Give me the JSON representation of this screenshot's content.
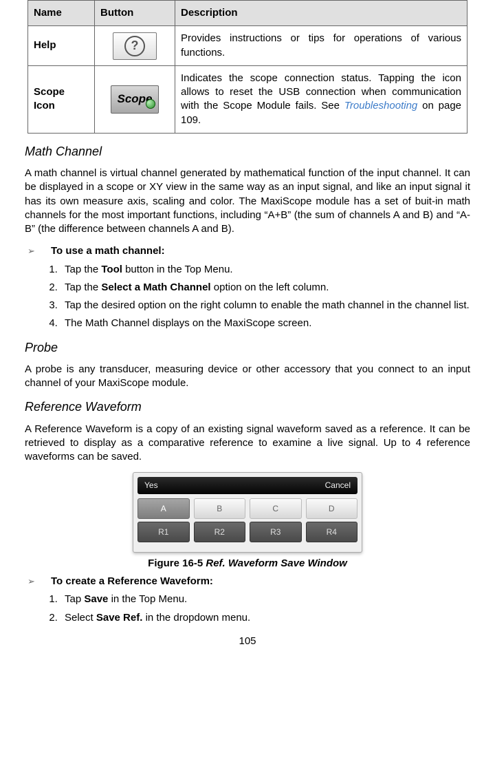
{
  "table": {
    "headers": {
      "name": "Name",
      "button": "Button",
      "desc": "Description"
    },
    "rows": {
      "help": {
        "name": "Help",
        "icon": "?",
        "desc": "Provides instructions or tips for operations of various functions."
      },
      "scope": {
        "name": "Scope Icon",
        "iconLabel": "Scope",
        "desc_pre": "Indicates the scope connection status. Tapping the icon allows to reset the USB connection when communication with the Scope Module fails. See ",
        "desc_link": "Troubleshooting",
        "desc_post": " on page 109."
      }
    }
  },
  "math": {
    "heading": "Math Channel",
    "para": "A math channel is virtual channel generated by mathematical function of the input channel. It can be displayed in a scope or XY view in the same way as an input signal, and like an input signal it has its own measure axis, scaling and color. The MaxiScope module has a set of buit-in math channels for the most important functions, including “A+B” (the sum of channels A and B) and “A-B” (the difference between channels A and B).",
    "bullet": "To use a math channel:",
    "steps": [
      {
        "pre": "Tap the ",
        "b": "Tool",
        "post": " button in the Top Menu."
      },
      {
        "pre": "Tap the ",
        "b": "Select a Math Channel",
        "post": " option on the left column."
      },
      {
        "text": "Tap the desired option on the right column to enable the math channel in the channel list."
      },
      {
        "text": "The Math Channel displays on the MaxiScope screen."
      }
    ]
  },
  "probe": {
    "heading": "Probe",
    "para": "A probe is any transducer, measuring device or other accessory that you connect to an input channel of your MaxiScope module."
  },
  "ref": {
    "heading": "Reference Waveform",
    "para": "A Reference Waveform is a copy of an existing signal waveform saved as a reference. It can be retrieved to display as a comparative reference to examine a live signal. Up to 4 reference waveforms can be saved.",
    "win": {
      "yes": "Yes",
      "cancel": "Cancel",
      "row1": [
        "A",
        "B",
        "C",
        "D"
      ],
      "row2": [
        "R1",
        "R2",
        "R3",
        "R4"
      ]
    },
    "caption_lead": "Figure 16-5 ",
    "caption_tail": "Ref. Waveform Save Window",
    "bullet": "To create a Reference Waveform:",
    "steps": [
      {
        "pre": "Tap ",
        "b": "Save",
        "post": " in the Top Menu."
      },
      {
        "pre": "Select ",
        "b": "Save Ref.",
        "post": " in the dropdown menu."
      }
    ]
  },
  "pageNumber": "105"
}
